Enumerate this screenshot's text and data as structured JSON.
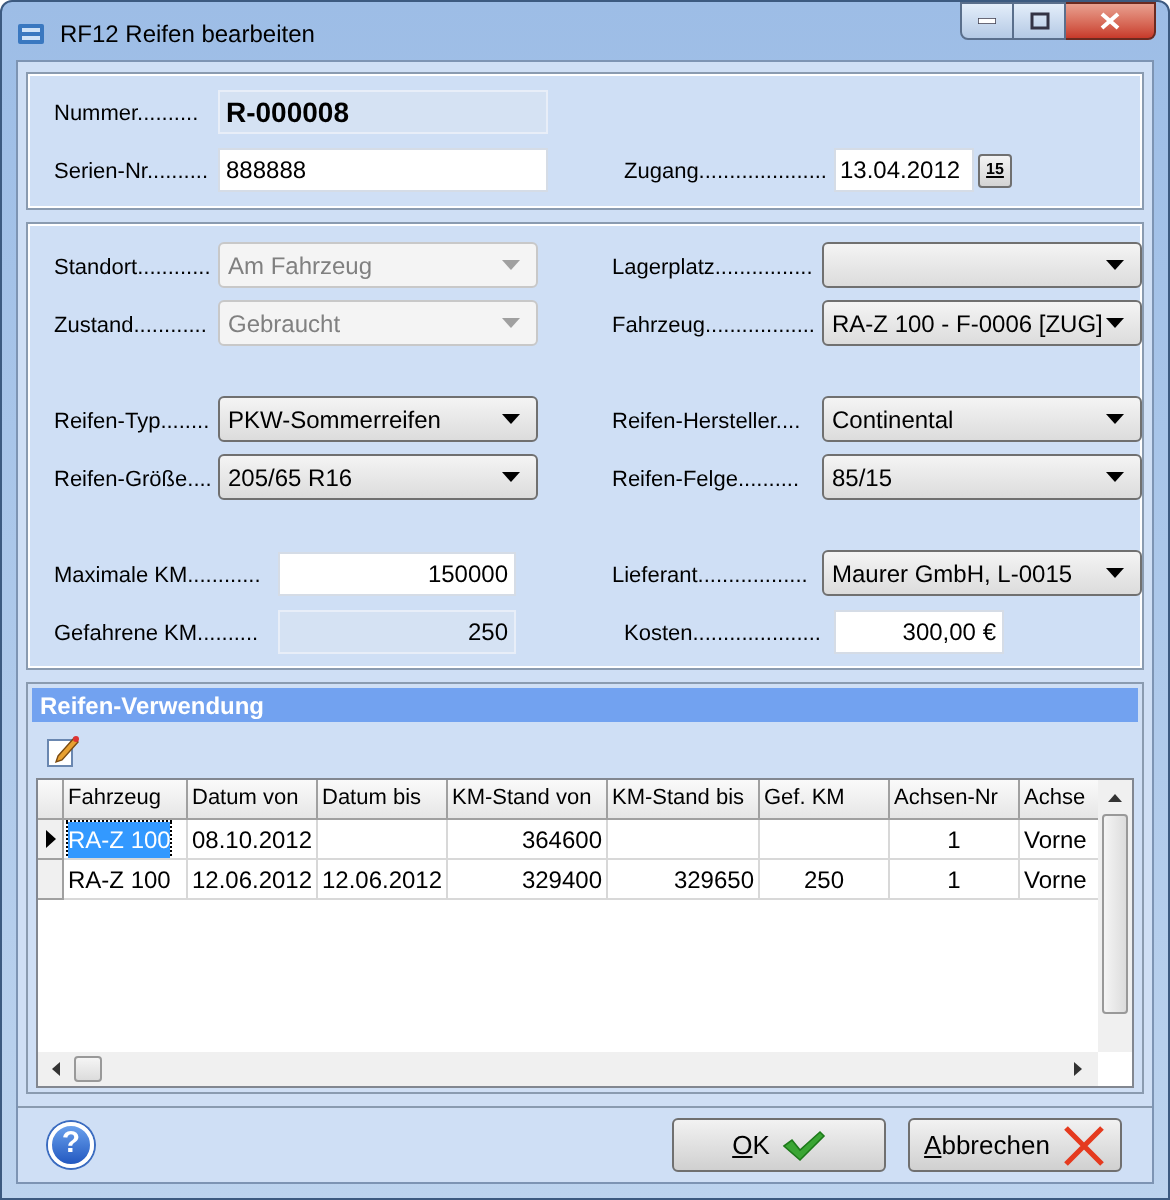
{
  "window": {
    "title": "RF12 Reifen bearbeiten"
  },
  "section_1": {
    "rows": [
      {
        "left": {
          "label": "Nummer..........",
          "value": "R-000008",
          "kind": "text",
          "readonly": true,
          "bold": true
        }
      },
      {
        "left": {
          "label": "Serien-Nr..........",
          "value": "888888",
          "kind": "text",
          "readonly": false,
          "bold": false
        },
        "right": {
          "label": "Zugang.....................",
          "value": "13.04.2012",
          "kind": "date",
          "button": "15"
        }
      }
    ]
  },
  "section_2": {
    "groups": [
      [
        {
          "left": {
            "label": "Standort............",
            "value": "Am Fahrzeug",
            "kind": "combo",
            "disabled": true
          },
          "right": {
            "label": "Lagerplatz................",
            "kind": "combo",
            "disabled": false
          }
        },
        {
          "left": {
            "label": "Zustand............",
            "value": "Gebraucht",
            "kind": "combo",
            "disabled": true
          },
          "right": {
            "label": "Fahrzeug..................",
            "value": "RA-Z 100  -  F-0006 [ZUG]",
            "kind": "combo",
            "disabled": false
          }
        }
      ],
      [
        {
          "left": {
            "label": "Reifen-Typ........",
            "value": "PKW-Sommerreifen",
            "kind": "combo",
            "disabled": false
          },
          "right": {
            "label": "Reifen-Hersteller....",
            "value": "Continental",
            "kind": "combo",
            "disabled": false
          }
        },
        {
          "left": {
            "label": "Reifen-Größe....",
            "value": "205/65 R16",
            "kind": "combo",
            "disabled": false
          },
          "right": {
            "label": "Reifen-Felge..........",
            "value": "85/15",
            "kind": "combo",
            "disabled": false
          }
        }
      ],
      [
        {
          "left": {
            "label": "Maximale KM............",
            "value": "150000",
            "kind": "number",
            "readonly": false
          },
          "right": {
            "label": "Lieferant..................",
            "value": "Maurer GmbH, L-0015",
            "kind": "combo",
            "disabled": false
          }
        },
        {
          "left": {
            "label": "Gefahrene KM..........",
            "value": "250",
            "kind": "number",
            "readonly": true
          },
          "right": {
            "label": "Kosten.....................",
            "value": "300,00 €",
            "kind": "number",
            "readonly": false
          }
        }
      ]
    ]
  },
  "usage": {
    "title": "Reifen-Verwendung",
    "table": {
      "columns": [
        "Fahrzeug",
        "Datum von",
        "Datum bis",
        "KM-Stand von",
        "KM-Stand bis",
        "Gef. KM",
        "Achsen-Nr",
        "Achse"
      ],
      "rows": [
        {
          "selected": true,
          "cells": [
            "RA-Z 100",
            "08.10.2012",
            "",
            "364600",
            "",
            "",
            "1",
            "Vorne"
          ]
        },
        {
          "selected": false,
          "cells": [
            "RA-Z 100",
            "12.06.2012",
            "12.06.2012",
            "329400",
            "329650",
            "250",
            "1",
            "Vorne"
          ]
        }
      ]
    }
  },
  "footer": {
    "help": "?",
    "buttons": [
      {
        "label": "OK",
        "kind": "ok"
      },
      {
        "label": "Abbrechen",
        "kind": "cancel"
      }
    ]
  }
}
